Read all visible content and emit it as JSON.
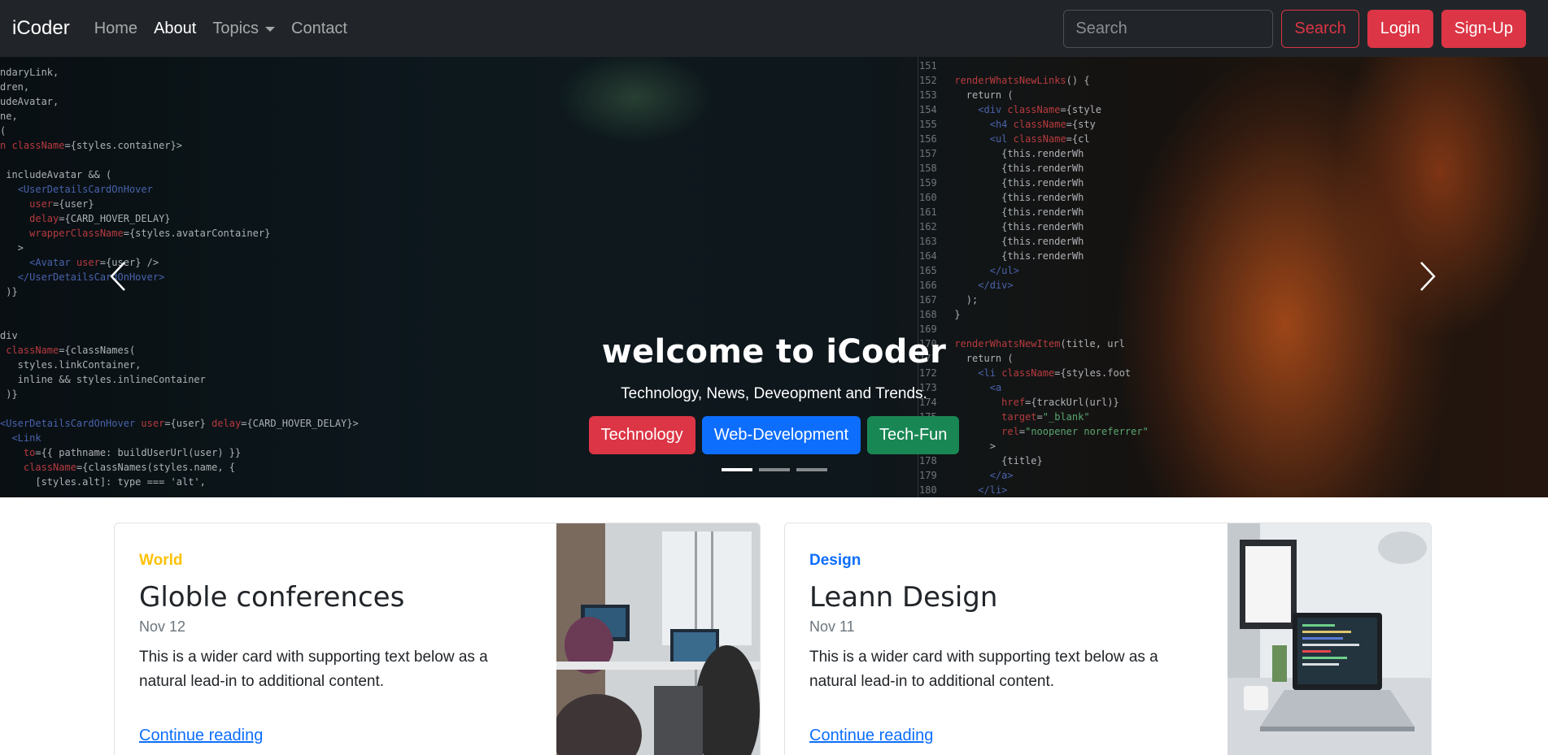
{
  "navbar": {
    "brand": "iCoder",
    "links": [
      {
        "label": "Home"
      },
      {
        "label": "About"
      },
      {
        "label": "Topics"
      },
      {
        "label": "Contact"
      }
    ],
    "search_placeholder": "Search",
    "search_button": "Search",
    "login_button": "Login",
    "signup_button": "Sign-Up"
  },
  "carousel": {
    "title": "welcome to iCoder",
    "subtitle": "Technology, News, Deveopment and Trends.",
    "buttons": [
      {
        "label": "Technology",
        "color": "#dc3545"
      },
      {
        "label": "Web-Development",
        "color": "#0d6efd"
      },
      {
        "label": "Tech-Fun",
        "color": "#198754"
      }
    ],
    "slides": 3,
    "active_slide": 1
  },
  "cards": [
    {
      "category": "World",
      "category_color": "#ffc107",
      "title": "Globle conferences",
      "date": "Nov 12",
      "text": "This is a wider card with supporting text below as a natural lead-in to additional content.",
      "link": "Continue reading"
    },
    {
      "category": "Design",
      "category_color": "#0d6efd",
      "title": "Leann Design",
      "date": "Nov 11",
      "text": "This is a wider card with supporting text below as a natural lead-in to additional content.",
      "link": "Continue reading"
    }
  ],
  "colors": {
    "navbar_bg": "#212529",
    "danger": "#dc3545",
    "primary": "#0d6efd",
    "success": "#198754",
    "warning": "#ffc107"
  }
}
